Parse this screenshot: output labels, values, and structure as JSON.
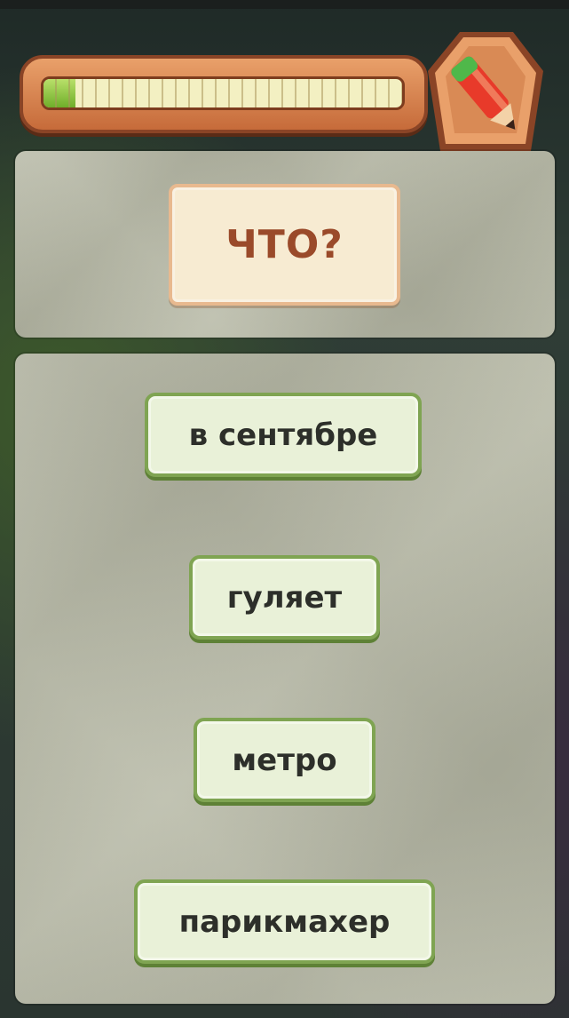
{
  "progress": {
    "fraction": 0.09
  },
  "question": {
    "text": "ЧТО?"
  },
  "answers": [
    {
      "label": "в сентябре"
    },
    {
      "label": "гуляет"
    },
    {
      "label": "метро"
    },
    {
      "label": "парикмахер"
    }
  ],
  "icons": {
    "badge": "pencil-icon"
  },
  "colors": {
    "accent": "#7fa452",
    "question_text": "#9a4a2a",
    "progress_fill": "#6fae2a"
  }
}
